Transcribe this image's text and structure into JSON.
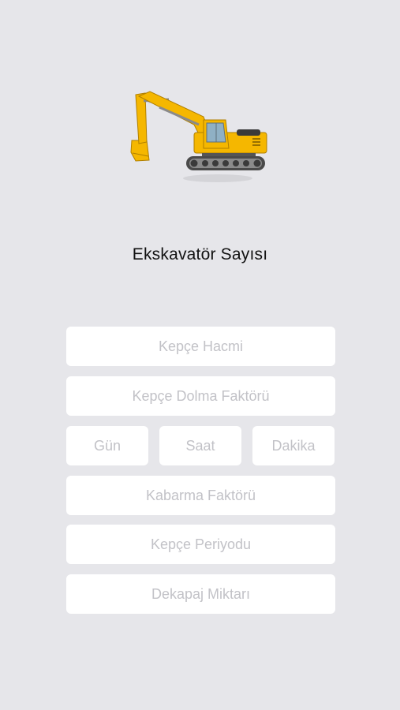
{
  "header": {
    "icon": "excavator-icon",
    "title": "Ekskavatör Sayısı"
  },
  "form": {
    "bucket_volume": {
      "placeholder": "Kepçe Hacmi",
      "value": ""
    },
    "bucket_fill_factor": {
      "placeholder": "Kepçe Dolma Faktörü",
      "value": ""
    },
    "days": {
      "placeholder": "Gün",
      "value": ""
    },
    "hours": {
      "placeholder": "Saat",
      "value": ""
    },
    "minutes": {
      "placeholder": "Dakika",
      "value": ""
    },
    "swell_factor": {
      "placeholder": "Kabarma Faktörü",
      "value": ""
    },
    "bucket_period": {
      "placeholder": "Kepçe Periyodu",
      "value": ""
    },
    "stripping_amount": {
      "placeholder": "Dekapaj Miktarı",
      "value": ""
    }
  },
  "colors": {
    "background": "#e6e6ea",
    "excavator_yellow": "#f5b700",
    "field_background": "#ffffff",
    "placeholder": "#c2c2c7"
  }
}
